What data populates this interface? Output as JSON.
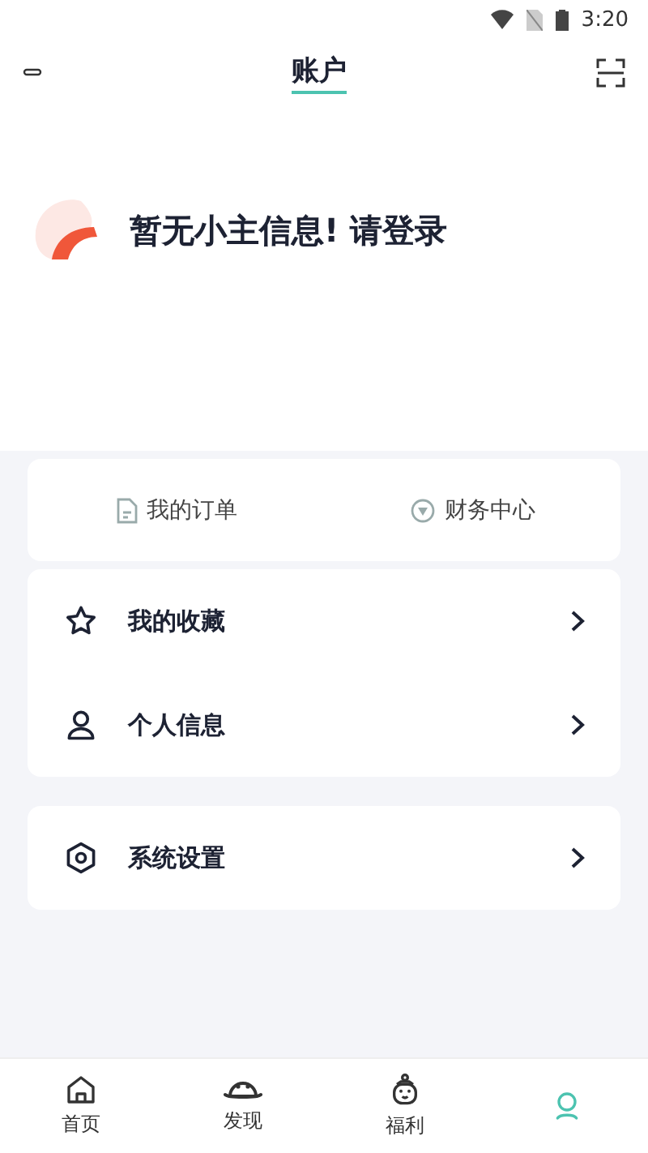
{
  "status_bar": {
    "time": "3:20"
  },
  "header": {
    "title": "账户"
  },
  "profile": {
    "message": "暂无小主信息! 请登录"
  },
  "quick_links": [
    {
      "label": "我的订单",
      "kind": "document"
    },
    {
      "label": "财务中心",
      "kind": "coin"
    }
  ],
  "menu_groups": [
    [
      {
        "label": "我的收藏",
        "kind": "star"
      },
      {
        "label": "个人信息",
        "kind": "person"
      }
    ],
    [
      {
        "label": "系统设置",
        "kind": "settings"
      }
    ]
  ],
  "bottom_nav": [
    {
      "label": "首页",
      "kind": "home",
      "selected": false
    },
    {
      "label": "发现",
      "kind": "planet",
      "selected": false
    },
    {
      "label": "福利",
      "kind": "gift",
      "selected": false
    },
    {
      "kind": "user",
      "selected": true
    }
  ]
}
